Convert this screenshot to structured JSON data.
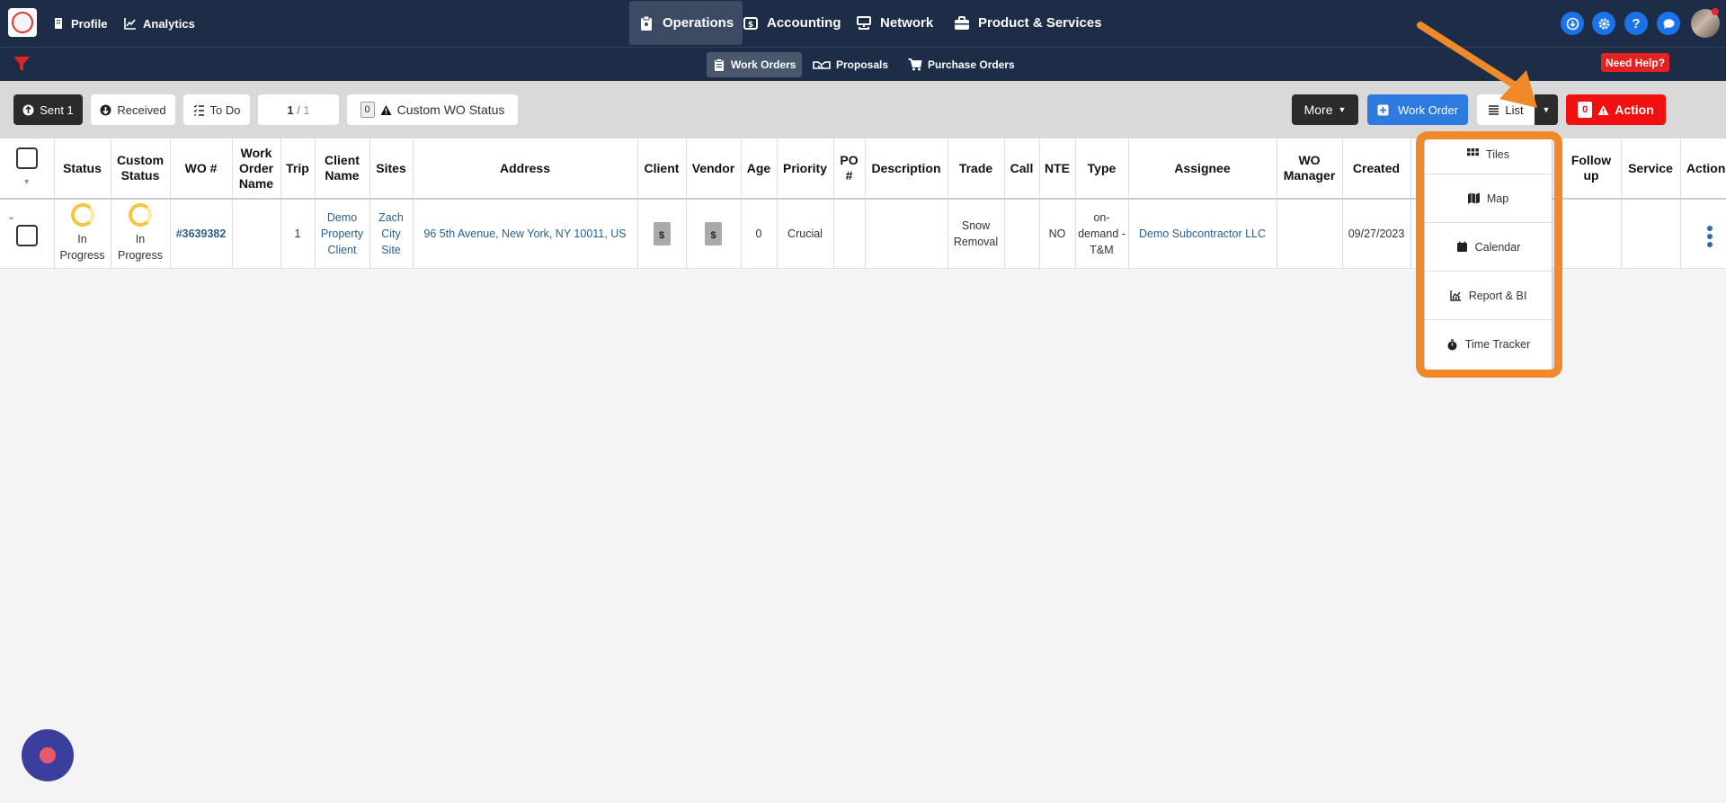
{
  "topnav": {
    "profile": "Profile",
    "analytics": "Analytics",
    "operations": "Operations",
    "accounting": "Accounting",
    "network": "Network",
    "products": "Product & Services"
  },
  "subnav": {
    "work_orders": "Work Orders",
    "proposals": "Proposals",
    "purchase_orders": "Purchase Orders",
    "need_help": "Need Help?"
  },
  "toolbar": {
    "sent": "Sent 1",
    "received": "Received",
    "todo": "To Do",
    "page_current": "1",
    "page_sep": " / ",
    "page_total": "1",
    "custom_count": "0",
    "custom_status": "Custom WO Status",
    "more": "More",
    "work_order": "Work Order",
    "list": "List",
    "action_count": "0",
    "action": "Action"
  },
  "table": {
    "headers": [
      "Status",
      "Custom Status",
      "WO #",
      "Work Order Name",
      "Trip",
      "Client Name",
      "Sites",
      "Address",
      "Client",
      "Vendor",
      "Age",
      "Priority",
      "PO #",
      "Description",
      "Trade",
      "Call",
      "NTE",
      "Type",
      "Assignee",
      "WO Manager",
      "Created",
      "",
      "Follow up",
      "Service",
      "Actions"
    ],
    "row": {
      "status": "In Progress",
      "custom_status": "In Progress",
      "wo_number": "#3639382",
      "trip": "1",
      "client_name": "Demo Property Client",
      "sites": "Zach City Site",
      "address": "96 5th Avenue, New York, NY 10011, US",
      "age": "0",
      "priority": "Crucial",
      "trade": "Snow Removal",
      "nte": "NO",
      "type": "on-demand - T&M",
      "assignee": "Demo Subcontractor LLC",
      "created": "09/27/2023"
    }
  },
  "dropdown": {
    "tiles": "Tiles",
    "map": "Map",
    "calendar": "Calendar",
    "report": "Report & BI",
    "time_tracker": "Time Tracker"
  },
  "colors": {
    "nav_bg": "#1d2d47",
    "primary": "#1a73e8",
    "danger": "#e32222",
    "highlight": "#f0892a"
  }
}
